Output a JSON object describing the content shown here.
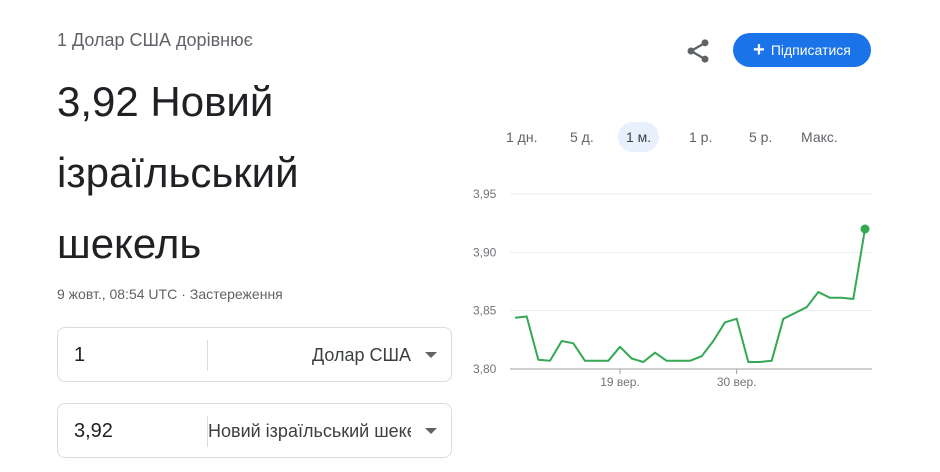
{
  "conversion": {
    "from_text": "1 Долар США дорівнює",
    "result_lines": [
      "3,92 Новий",
      "ізраїльський",
      "шекель"
    ],
    "timestamp": "9 жовт., 08:54 UTC",
    "separator": "·",
    "disclaimer": "Застереження"
  },
  "inputs": {
    "from": {
      "amount": "1",
      "currency": "Долар США"
    },
    "to": {
      "amount": "3,92",
      "currency": "Новий ізраїльський шекель"
    }
  },
  "actions": {
    "subscribe_label": "Підписатися",
    "subscribe_icon": "plus-icon",
    "share_icon": "share-icon"
  },
  "ranges": {
    "items": [
      "1 дн.",
      "5 д.",
      "1 м.",
      "1 р.",
      "5 р.",
      "Макс."
    ],
    "selected": "1 м."
  },
  "colors": {
    "accent": "#1a73e8",
    "line": "#34a853",
    "text_secondary": "#5f6368"
  },
  "chart_data": {
    "type": "line",
    "y_ticks": [
      "3,95",
      "3,90",
      "3,85",
      "3,80"
    ],
    "y_tick_values": [
      3.95,
      3.9,
      3.85,
      3.8
    ],
    "ylim": [
      3.8,
      3.95
    ],
    "x_tick_labels": [
      "19 вер.",
      "30 вер."
    ],
    "x_tick_index": [
      9,
      19
    ],
    "grid": true,
    "values": [
      3.844,
      3.845,
      3.808,
      3.807,
      3.824,
      3.822,
      3.807,
      3.807,
      3.807,
      3.819,
      3.809,
      3.806,
      3.814,
      3.807,
      3.807,
      3.807,
      3.811,
      3.824,
      3.84,
      3.843,
      3.806,
      3.806,
      3.807,
      3.843,
      3.848,
      3.853,
      3.866,
      3.861,
      3.861,
      3.86,
      3.92
    ]
  }
}
